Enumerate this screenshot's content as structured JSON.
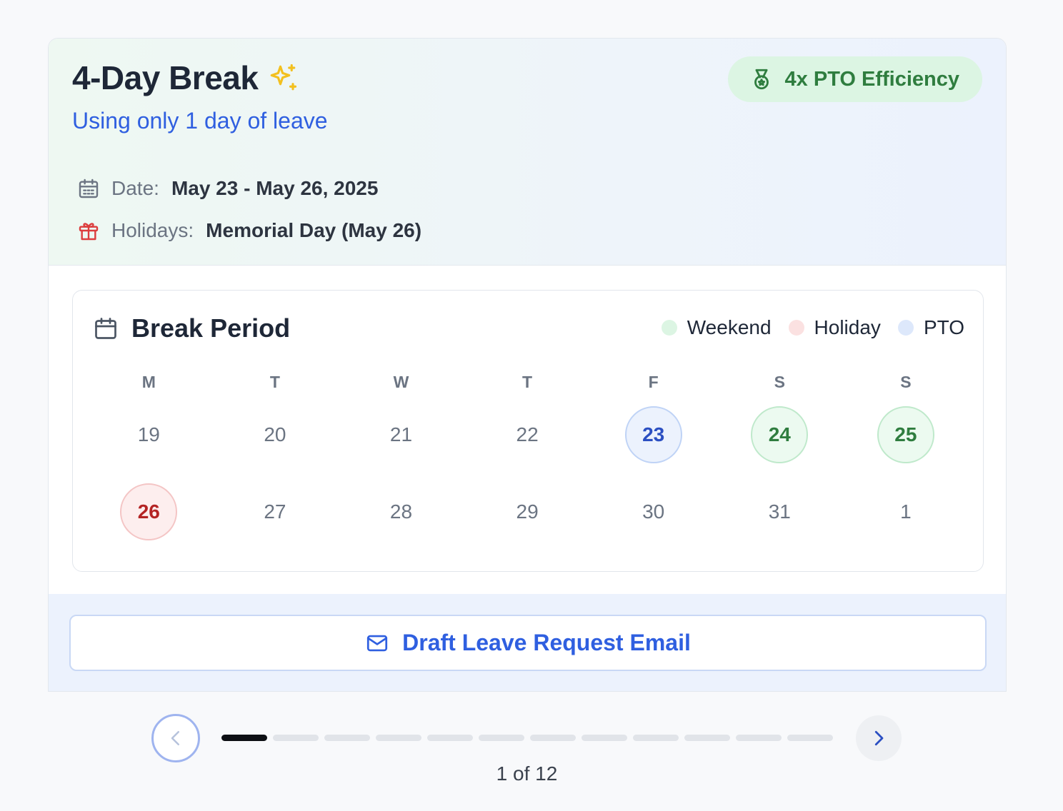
{
  "header": {
    "title": "4-Day Break",
    "subtitle": "Using only 1 day of leave",
    "badge": "4x PTO Efficiency",
    "date_label": "Date:",
    "date_value": "May 23 - May 26, 2025",
    "holidays_label": "Holidays:",
    "holidays_value": "Memorial Day (May 26)"
  },
  "calendar": {
    "title": "Break Period",
    "legend": [
      {
        "label": "Weekend",
        "color": "#dcf5e3"
      },
      {
        "label": "Holiday",
        "color": "#fbe1e1"
      },
      {
        "label": "PTO",
        "color": "#dde8fb"
      }
    ],
    "weekdays": [
      "M",
      "T",
      "W",
      "T",
      "F",
      "S",
      "S"
    ],
    "days": [
      {
        "n": "19",
        "type": ""
      },
      {
        "n": "20",
        "type": ""
      },
      {
        "n": "21",
        "type": ""
      },
      {
        "n": "22",
        "type": ""
      },
      {
        "n": "23",
        "type": "pto"
      },
      {
        "n": "24",
        "type": "weekend"
      },
      {
        "n": "25",
        "type": "weekend"
      },
      {
        "n": "26",
        "type": "holiday"
      },
      {
        "n": "27",
        "type": ""
      },
      {
        "n": "28",
        "type": ""
      },
      {
        "n": "29",
        "type": ""
      },
      {
        "n": "30",
        "type": ""
      },
      {
        "n": "31",
        "type": ""
      },
      {
        "n": "1",
        "type": ""
      }
    ]
  },
  "action": {
    "email_button": "Draft Leave Request Email"
  },
  "pager": {
    "current": 1,
    "total": 12,
    "label": "1 of 12"
  },
  "icons": {
    "sparkle": "sparkles-icon",
    "badge": "medal-icon",
    "date": "calendar-days-icon",
    "holidays": "gift-icon",
    "calendar": "calendar-icon",
    "email": "mail-icon",
    "prev": "chevron-left-icon",
    "next": "chevron-right-icon"
  }
}
